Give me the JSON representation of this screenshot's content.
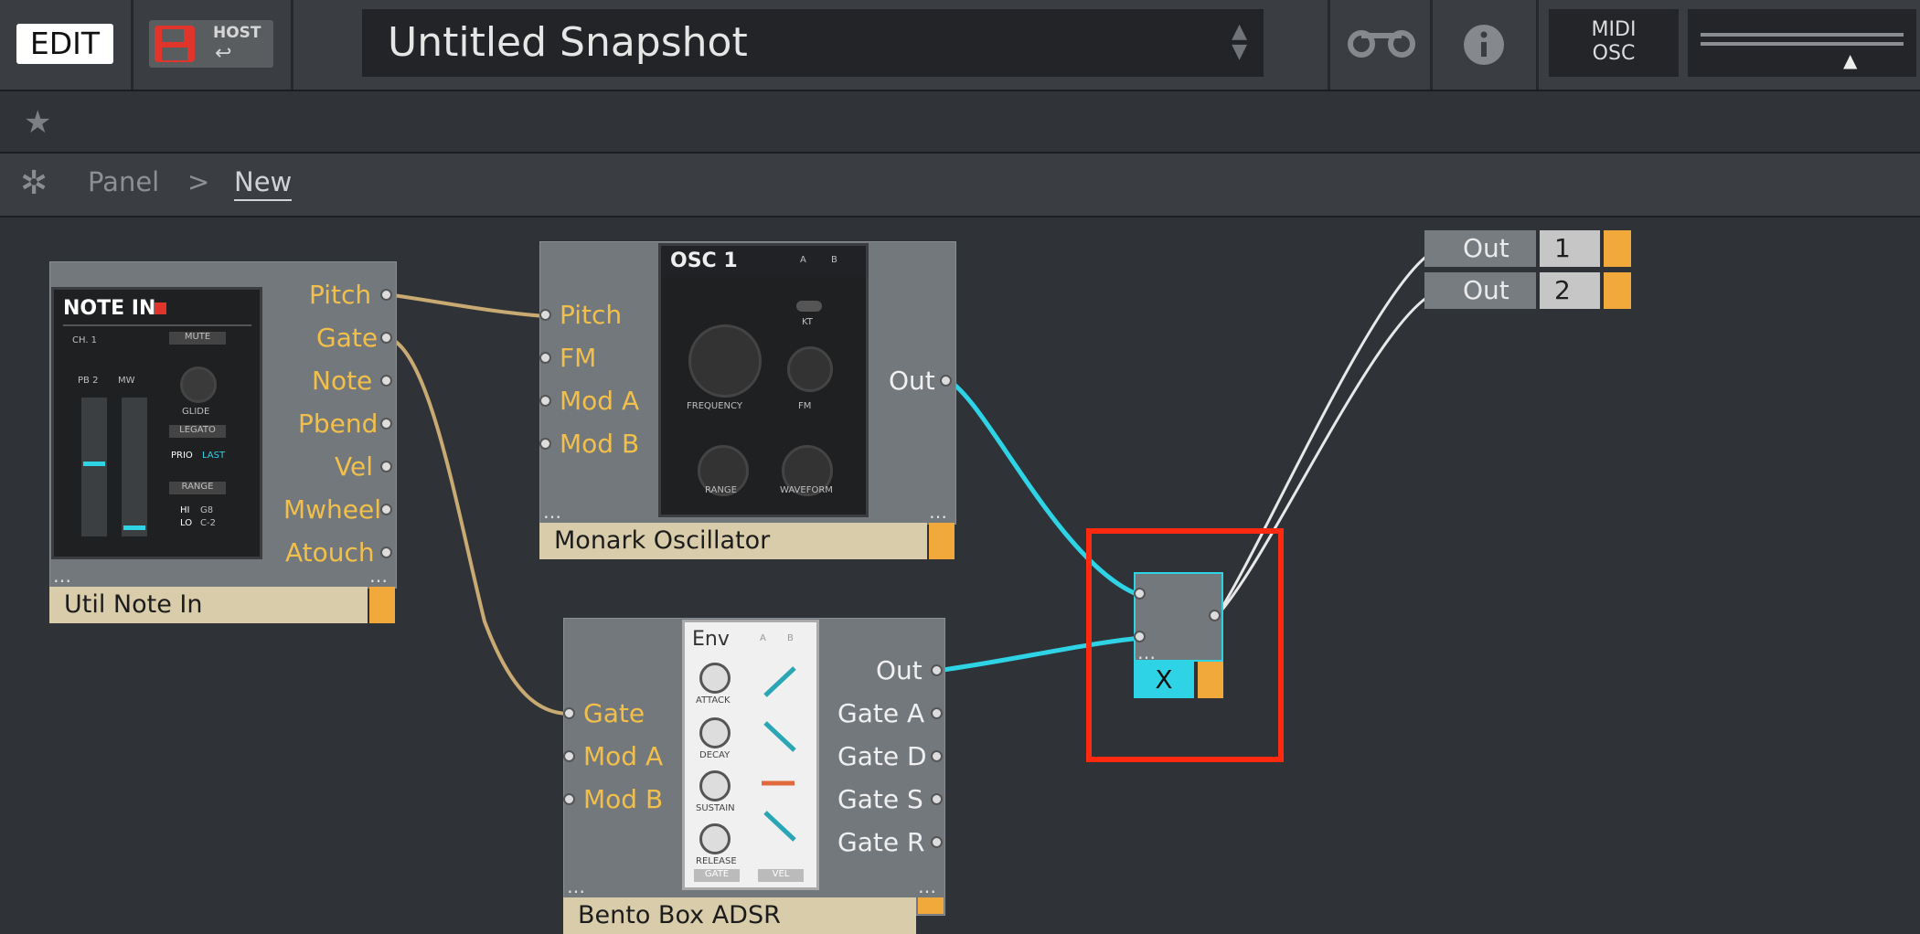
{
  "toolbar": {
    "edit_label": "EDIT",
    "host_label": "HOST",
    "snapshot_name": "Untitled Snapshot",
    "midi_label": "MIDI",
    "osc_label": "OSC"
  },
  "breadcrumb": {
    "root": "Panel",
    "separator": ">",
    "current": "New"
  },
  "modules": {
    "note_in": {
      "name": "Util Note In",
      "panel_title": "NOTE IN",
      "panel_labels": [
        "CH. 1",
        "MUTE",
        "PB 2",
        "MW",
        "GLIDE",
        "LEGATO",
        "PRIO",
        "LAST",
        "RANGE",
        "HI",
        "G8",
        "LO",
        "C-2"
      ],
      "ports": [
        "Pitch",
        "Gate",
        "Note",
        "Pbend",
        "Vel",
        "Mwheel",
        "Atouch"
      ]
    },
    "oscillator": {
      "name": "Monark Oscillator",
      "panel_title": "OSC 1",
      "panel_labels": [
        "FREQUENCY",
        "KT",
        "FM",
        "RANGE",
        "WAVEFORM",
        "A",
        "B"
      ],
      "inputs": [
        "Pitch",
        "FM",
        "Mod A",
        "Mod B"
      ],
      "output": "Out"
    },
    "envelope": {
      "name": "Bento Box ADSR",
      "panel_title": "Env",
      "panel_labels": [
        "ATTACK",
        "DECAY",
        "SUSTAIN",
        "RELEASE",
        "GATE",
        "VEL",
        "A",
        "B"
      ],
      "inputs": [
        "Gate",
        "Mod A",
        "Mod B"
      ],
      "outputs": [
        "Out",
        "Gate A",
        "Gate D",
        "Gate S",
        "Gate R"
      ]
    },
    "multiply": {
      "name": "X"
    },
    "outputs": [
      {
        "label": "Out",
        "channel": "1"
      },
      {
        "label": "Out",
        "channel": "2"
      }
    ]
  },
  "colors": {
    "accent": "#f2a93b",
    "cable_cyan": "#2fd3e6",
    "cable_tan": "#c8aa72",
    "selection": "#ff2a10"
  }
}
